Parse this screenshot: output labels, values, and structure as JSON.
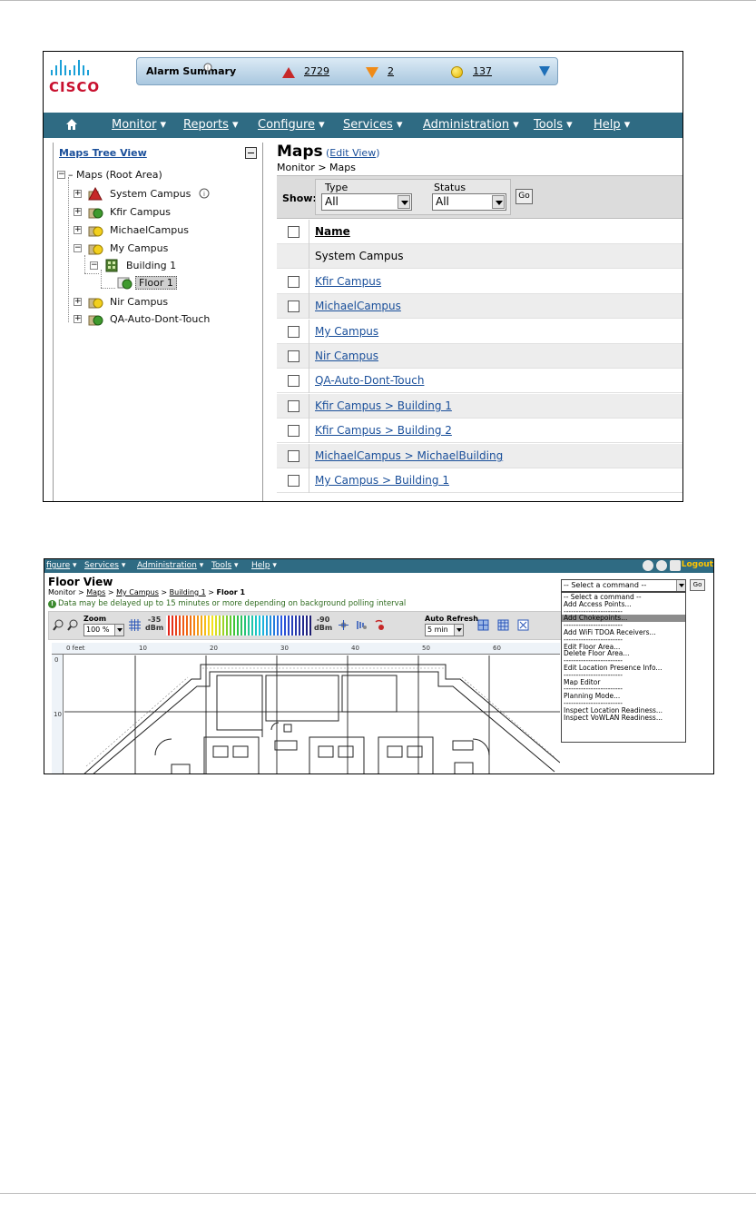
{
  "screen1": {
    "logo_text": "CISCO",
    "alarm": {
      "title": "Alarm Summary",
      "critical_count": "2729",
      "major_count": "2",
      "minor_count": "137",
      "colors": {
        "critical": "#c62828",
        "major": "#f08b17",
        "minor": "#e4b400"
      }
    },
    "nav": [
      "Monitor",
      "Reports",
      "Configure",
      "Services",
      "Administration",
      "Tools",
      "Help"
    ],
    "tree": {
      "title": "Maps Tree View",
      "root": "Maps (Root Area)",
      "items": [
        "System Campus",
        "Kfir Campus",
        "MichaelCampus",
        "My Campus",
        "Building 1",
        "Floor 1",
        "Nir Campus",
        "QA-Auto-Dont-Touch"
      ]
    },
    "maps": {
      "title": "Maps",
      "edit_view": "Edit View",
      "breadcrumb_parent": "Monitor",
      "breadcrumb_sep": ">",
      "breadcrumb_current": "Maps",
      "show_label": "Show:",
      "type_label": "Type",
      "type_value": "All",
      "status_label": "Status",
      "status_value": "All",
      "go_label": "Go",
      "column_name": "Name",
      "rows": [
        "System Campus",
        "Kfir Campus",
        "MichaelCampus",
        "My Campus",
        "Nir Campus",
        "QA-Auto-Dont-Touch",
        "Kfir Campus > Building 1",
        "Kfir Campus > Building 2",
        "MichaelCampus > MichaelBuilding",
        "My Campus > Building 1"
      ]
    }
  },
  "screen2": {
    "nav": [
      "figure",
      "Services",
      "Administration",
      "Tools",
      "Help"
    ],
    "logout": "Logout",
    "title": "Floor View",
    "breadcrumb": [
      "Monitor",
      "Maps",
      "My Campus",
      "Building 1",
      "Floor 1"
    ],
    "note": "Data may be delayed up to 15 minutes or more depending on background polling interval",
    "zoom_label": "Zoom",
    "zoom_value": "100 %",
    "dbm_min_value": "-35",
    "dbm_max_value": "-90",
    "dbm_unit": "dBm",
    "auto_refresh_label": "Auto Refresh",
    "auto_refresh_value": "5 min",
    "ruler_x": [
      "0 feet",
      "10",
      "20",
      "30",
      "40",
      "50",
      "60"
    ],
    "ruler_y": [
      "0",
      "10"
    ],
    "command_select": "-- Select a command --",
    "command_go": "Go",
    "command_options": [
      "-- Select a command --",
      "Add Access Points...",
      "------------------------",
      "Add Chokepoints...",
      "------------------------",
      "Add WiFi TDOA Receivers...",
      "------------------------",
      "Edit Floor Area...",
      "Delete Floor Area...",
      "------------------------",
      "Edit Location Presence Info...",
      "------------------------",
      "Map Editor",
      "------------------------",
      "Planning Mode...",
      "------------------------",
      "Inspect Location Readiness...",
      "Inspect VoWLAN Readiness..."
    ],
    "highlighted_command_index": 3
  }
}
